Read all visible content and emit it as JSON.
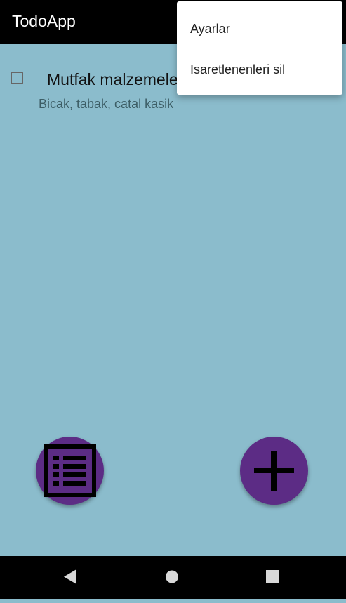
{
  "appbar": {
    "title": "TodoApp"
  },
  "todos": [
    {
      "title": "Mutfak malzemeleri",
      "description": "Bicak, tabak, catal kasik",
      "checked": false
    }
  ],
  "menu": {
    "items": [
      {
        "label": "Ayarlar"
      },
      {
        "label": "Isaretlenenleri sil"
      }
    ]
  },
  "fabs": {
    "list_icon": "list-icon",
    "add_icon": "plus-icon"
  },
  "navbar": {
    "back_icon": "back-triangle-icon",
    "home_icon": "home-circle-icon",
    "recents_icon": "recents-square-icon"
  },
  "colors": {
    "background": "#8bbccc",
    "appbar": "#000000",
    "fab": "#5c2c85"
  }
}
